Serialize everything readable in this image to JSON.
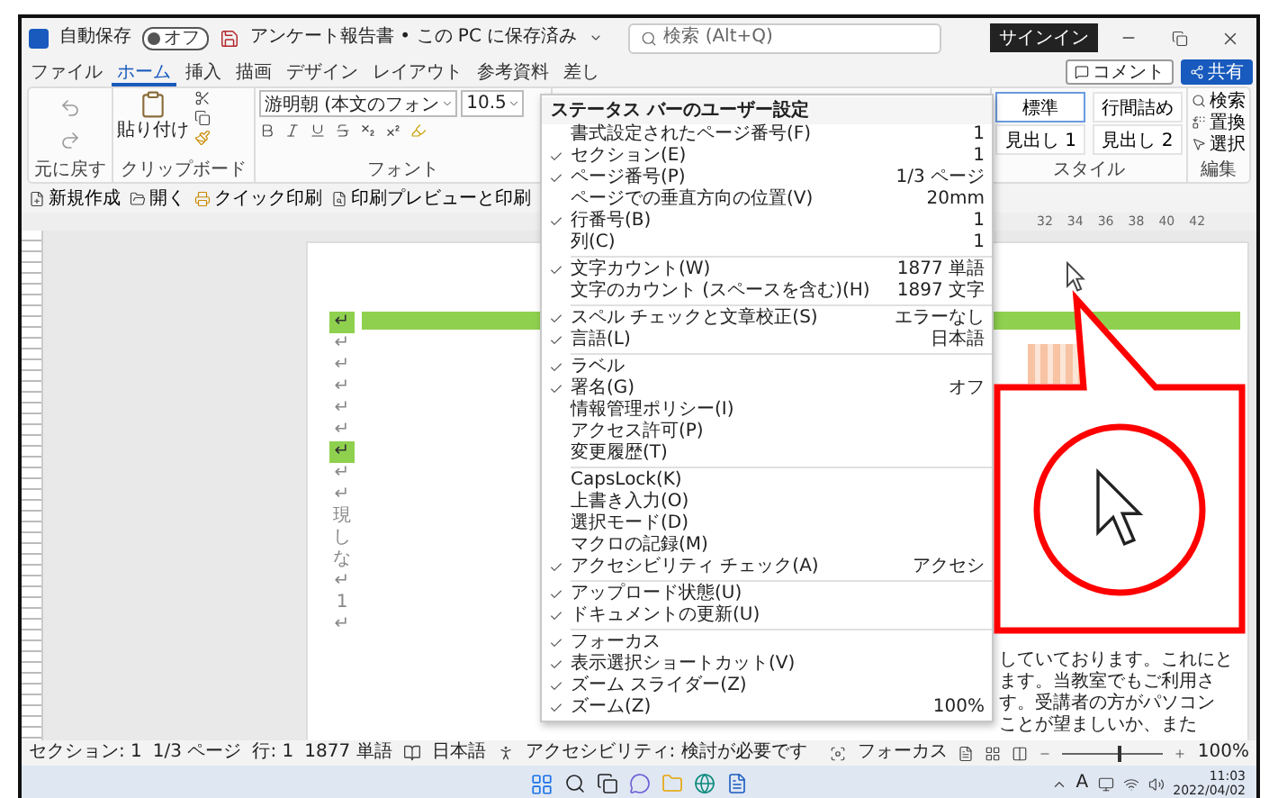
{
  "title_bar": {
    "autosave_label": "自動保存",
    "autosave": {
      "label": "オフ",
      "on": false
    },
    "document_title": "アンケート報告書 • この PC に保存済み",
    "search_placeholder": "検索 (Alt+Q)",
    "sign_in": "サインイン"
  },
  "ribbon_tabs": [
    {
      "label": "ファイル",
      "selected": false
    },
    {
      "label": "ホーム",
      "selected": true
    },
    {
      "label": "挿入",
      "selected": false
    },
    {
      "label": "描画",
      "selected": false
    },
    {
      "label": "デザイン",
      "selected": false
    },
    {
      "label": "レイアウト",
      "selected": false
    },
    {
      "label": "参考資料",
      "selected": false
    },
    {
      "label": "差し",
      "selected": false
    }
  ],
  "ribbon_buttons": [
    {
      "label": "コメント",
      "kind": "outline"
    },
    {
      "label": "共有",
      "kind": "primary"
    }
  ],
  "ribbon": {
    "undo_label": "元に戻す",
    "paste_label": "貼り付け",
    "clipboard_label": "クリップボード",
    "font_name": "游明朝 (本文のフォン",
    "font_size": "10.5",
    "font_label": "フォント",
    "styles": [
      {
        "label": "標準",
        "selected": true
      },
      {
        "label": "行間詰め",
        "selected": false
      },
      {
        "label": "見出し 1",
        "selected": false
      },
      {
        "label": "見出し 2",
        "selected": false
      }
    ],
    "styles_label": "スタイル",
    "editing": [
      "検索",
      "置換",
      "選択"
    ],
    "editing_label": "編集"
  },
  "quick_access": [
    "新規作成",
    "開く",
    "クイック印刷",
    "印刷プレビューと印刷"
  ],
  "ruler_numbers": [
    "32",
    "34",
    "36",
    "38",
    "40",
    "42"
  ],
  "document": {
    "marks": [
      {
        "text": "↵",
        "highlight": true
      },
      {
        "text": "↵",
        "highlight": false
      },
      {
        "text": "↵",
        "highlight": false
      },
      {
        "text": "↵",
        "highlight": false
      },
      {
        "text": "↵",
        "highlight": false
      },
      {
        "text": "↵",
        "highlight": false
      },
      {
        "text": "↵",
        "highlight": true
      },
      {
        "text": "↵",
        "highlight": false
      },
      {
        "text": "↵",
        "highlight": false
      },
      {
        "text": "現",
        "highlight": false
      },
      {
        "text": "し",
        "highlight": false
      },
      {
        "text": "な",
        "highlight": false
      },
      {
        "text": "↵",
        "highlight": false
      },
      {
        "text": "1",
        "highlight": false
      },
      {
        "text": "↵",
        "highlight": false
      }
    ],
    "text_lines": [
      "していております。これにと",
      "ます。当教室でもご利用さ",
      "す。受講者の方がパソコン",
      "ことが望ましいか、また"
    ]
  },
  "context_menu": {
    "title": "ステータス バーのユーザー設定",
    "groups": [
      [
        {
          "label": "書式設定されたページ番号(F)",
          "value": "1",
          "checked": false
        },
        {
          "label": "セクション(E)",
          "value": "1",
          "checked": true
        },
        {
          "label": "ページ番号(P)",
          "value": "1/3 ページ",
          "checked": true
        },
        {
          "label": "ページでの垂直方向の位置(V)",
          "value": "20mm",
          "checked": false
        },
        {
          "label": "行番号(B)",
          "value": "1",
          "checked": true
        },
        {
          "label": "列(C)",
          "value": "1",
          "checked": false
        }
      ],
      [
        {
          "label": "文字カウント(W)",
          "value": "1877 単語",
          "checked": true
        },
        {
          "label": "文字のカウント (スペースを含む)(H)",
          "value": "1897 文字",
          "checked": false
        }
      ],
      [
        {
          "label": "スペル チェックと文章校正(S)",
          "value": "エラーなし",
          "checked": true
        },
        {
          "label": "言語(L)",
          "value": "日本語",
          "checked": true
        }
      ],
      [
        {
          "label": "ラベル",
          "checked": true
        },
        {
          "label": "署名(G)",
          "value": "オフ",
          "checked": true
        },
        {
          "label": "情報管理ポリシー(I)",
          "checked": false
        },
        {
          "label": "アクセス許可(P)",
          "checked": false
        },
        {
          "label": "変更履歴(T)",
          "checked": false
        }
      ],
      [
        {
          "label": "CapsLock(K)",
          "checked": false
        },
        {
          "label": "上書き入力(O)",
          "checked": false
        },
        {
          "label": "選択モード(D)",
          "checked": false
        },
        {
          "label": "マクロの記録(M)",
          "checked": false
        },
        {
          "label": "アクセシビリティ チェック(A)",
          "value": "アクセシ",
          "checked": true
        }
      ],
      [
        {
          "label": "アップロード状態(U)",
          "checked": true
        },
        {
          "label": "ドキュメントの更新(U)",
          "checked": true
        }
      ],
      [
        {
          "label": "フォーカス",
          "checked": true
        },
        {
          "label": "表示選択ショートカット(V)",
          "checked": true
        },
        {
          "label": "ズーム スライダー(Z)",
          "checked": true
        },
        {
          "label": "ズーム(Z)",
          "value": "100%",
          "checked": true
        }
      ]
    ]
  },
  "status_bar": {
    "items": [
      "セクション: 1",
      "1/3 ページ",
      "行: 1",
      "1877 単語"
    ],
    "language": "日本語",
    "accessibility": "アクセシビリティ: 検討が必要です",
    "focus": "フォーカス",
    "zoom": {
      "level": 0.55,
      "label": "100%"
    }
  },
  "taskbar": {
    "ime": "A",
    "time": "11:03",
    "date": "2022/04/02"
  }
}
